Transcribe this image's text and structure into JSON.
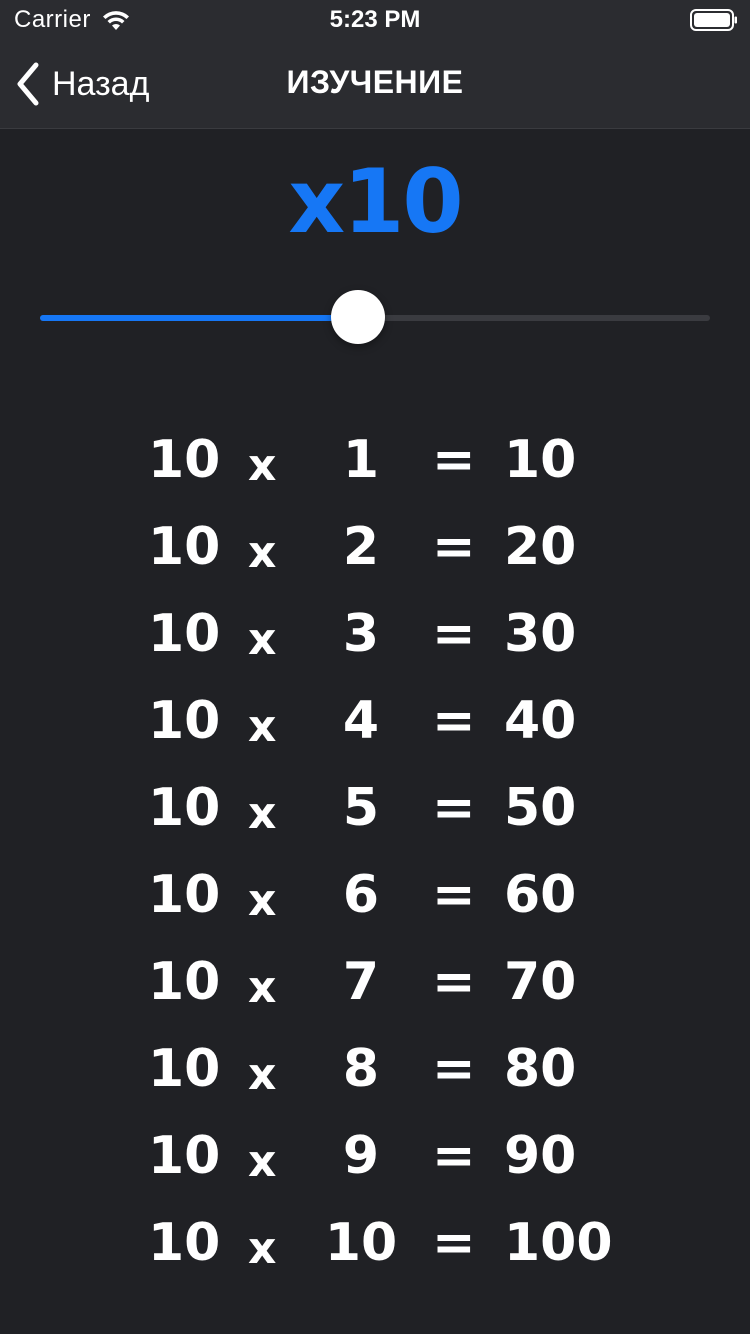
{
  "status_bar": {
    "carrier": "Carrier",
    "time": "5:23 PM",
    "wifi_icon": "wifi-icon",
    "battery_icon": "battery-icon"
  },
  "nav": {
    "back_label": "Назад",
    "back_icon": "chevron-left-icon",
    "title": "ИЗУЧЕНИЕ"
  },
  "multiplier": {
    "label": "x10",
    "accent_color": "#1677f5"
  },
  "slider": {
    "value_fraction": 0.475,
    "track_color": "#3a3b40",
    "fill_color": "#1677f5"
  },
  "table": {
    "rows": [
      {
        "a": "10",
        "op": "x",
        "b": "1",
        "eq": "=",
        "result": "10"
      },
      {
        "a": "10",
        "op": "x",
        "b": "2",
        "eq": "=",
        "result": "20"
      },
      {
        "a": "10",
        "op": "x",
        "b": "3",
        "eq": "=",
        "result": "30"
      },
      {
        "a": "10",
        "op": "x",
        "b": "4",
        "eq": "=",
        "result": "40"
      },
      {
        "a": "10",
        "op": "x",
        "b": "5",
        "eq": "=",
        "result": "50"
      },
      {
        "a": "10",
        "op": "x",
        "b": "6",
        "eq": "=",
        "result": "60"
      },
      {
        "a": "10",
        "op": "x",
        "b": "7",
        "eq": "=",
        "result": "70"
      },
      {
        "a": "10",
        "op": "x",
        "b": "8",
        "eq": "=",
        "result": "80"
      },
      {
        "a": "10",
        "op": "x",
        "b": "9",
        "eq": "=",
        "result": "90"
      },
      {
        "a": "10",
        "op": "x",
        "b": "10",
        "eq": "=",
        "result": "100"
      }
    ]
  }
}
